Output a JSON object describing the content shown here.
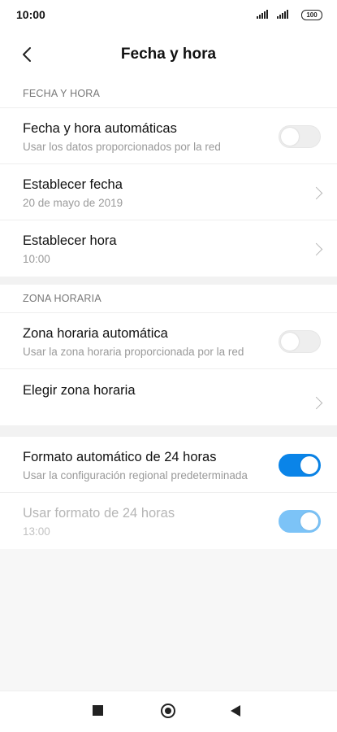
{
  "status_bar": {
    "time": "10:00",
    "battery": "100"
  },
  "header": {
    "title": "Fecha y hora"
  },
  "sections": {
    "date_time": {
      "label": "FECHA Y HORA",
      "auto": {
        "title": "Fecha y hora automáticas",
        "subtitle": "Usar los datos proporcionados por la red",
        "enabled": false
      },
      "set_date": {
        "title": "Establecer fecha",
        "value": "20 de mayo de 2019"
      },
      "set_time": {
        "title": "Establecer hora",
        "value": "10:00"
      }
    },
    "time_zone": {
      "label": "ZONA HORARIA",
      "auto": {
        "title": "Zona horaria automática",
        "subtitle": "Usar la zona horaria proporcionada por la red",
        "enabled": false
      },
      "choose": {
        "title": "Elegir zona horaria"
      }
    },
    "format": {
      "auto24": {
        "title": "Formato automático de 24 horas",
        "subtitle": "Usar la configuración regional predeterminada",
        "enabled": true
      },
      "use24": {
        "title": "Usar formato de 24 horas",
        "subtitle": "13:00",
        "enabled": true,
        "disabled": true
      }
    }
  },
  "colors": {
    "accent": "#0a84e8",
    "accent_dim": "#7cc3f7"
  }
}
